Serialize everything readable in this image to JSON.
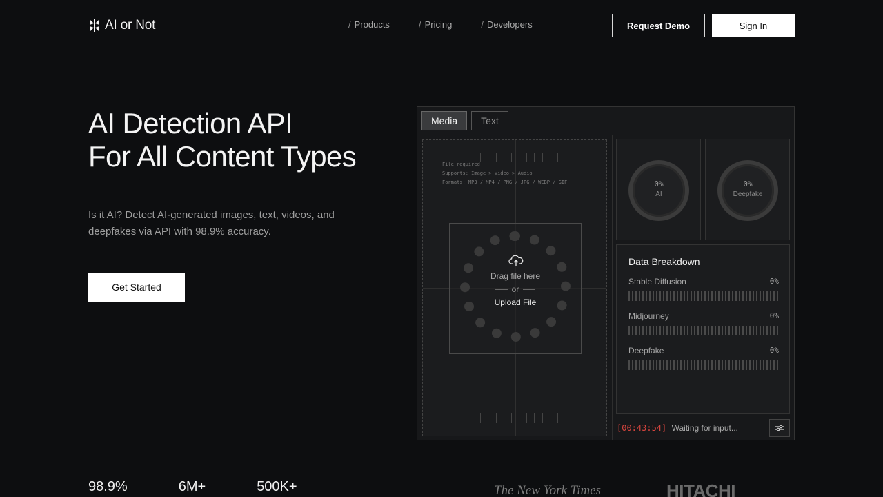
{
  "nav": {
    "logo_text": "AI or Not",
    "links": [
      "Products",
      "Pricing",
      "Developers"
    ],
    "request_demo": "Request Demo",
    "sign_in": "Sign In"
  },
  "hero": {
    "title_line1": "AI Detection API",
    "title_line2": "For All Content Types",
    "subtitle": "Is it AI? Detect AI-generated images, text, videos, and deepfakes via API with 98.9% accuracy.",
    "cta": "Get Started"
  },
  "panel": {
    "tabs": [
      {
        "label": "Media",
        "active": true
      },
      {
        "label": "Text",
        "active": false
      }
    ],
    "upload": {
      "info_line1": "File required",
      "info_line2": "Supports: Image > Video > Audio",
      "info_line3": "Formats: MP3 / MP4 / PNG / JPG / WEBP / GIF",
      "drag_text": "Drag file here",
      "or_text": "or",
      "upload_link": "Upload File"
    },
    "gauges": [
      {
        "value": "0%",
        "label": "AI"
      },
      {
        "value": "0%",
        "label": "Deepfake"
      }
    ],
    "breakdown": {
      "title": "Data Breakdown",
      "rows": [
        {
          "name": "Stable Diffusion",
          "pct": "0%"
        },
        {
          "name": "Midjourney",
          "pct": "0%"
        },
        {
          "name": "Deepfake",
          "pct": "0%"
        }
      ]
    },
    "status": {
      "time": "[00:43:54]",
      "message": "Waiting for input..."
    },
    "icons": {
      "upload": "cloud-upload-icon",
      "settings": "sliders-icon"
    }
  },
  "stats": [
    "98.9%",
    "6M+",
    "500K+"
  ],
  "press": [
    "The New York Times",
    "HITACHI"
  ]
}
